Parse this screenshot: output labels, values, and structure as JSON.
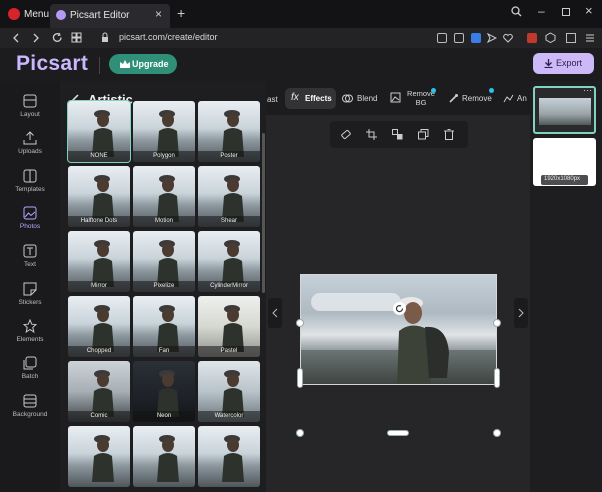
{
  "browser": {
    "menu_label": "Menu",
    "tab_title": "Picsart Editor",
    "url": "picsart.com/create/editor"
  },
  "header": {
    "logo": "Picsart",
    "upgrade_label": "Upgrade",
    "export_label": "Export"
  },
  "sidebar": {
    "items": [
      {
        "label": "Layout",
        "icon": "layout-icon"
      },
      {
        "label": "Uploads",
        "icon": "upload-icon"
      },
      {
        "label": "Templates",
        "icon": "templates-icon"
      },
      {
        "label": "Photos",
        "icon": "photos-icon"
      },
      {
        "label": "Text",
        "icon": "text-icon"
      },
      {
        "label": "Stickers",
        "icon": "stickers-icon"
      },
      {
        "label": "Elements",
        "icon": "elements-icon"
      },
      {
        "label": "Batch",
        "icon": "batch-icon"
      },
      {
        "label": "Background",
        "icon": "background-icon"
      }
    ]
  },
  "panel": {
    "title": "Artistic",
    "effects": [
      "NONE",
      "Polygon",
      "Poster",
      "Halftone Dots",
      "Motion",
      "Shear",
      "Mirror",
      "Pixelize",
      "CylinderMirror",
      "Chopped",
      "Fan",
      "Pastel",
      "Comic",
      "Neon",
      "Watercolor",
      "",
      "",
      ""
    ]
  },
  "toolbar": {
    "partial_label": "ast",
    "tabs": [
      "Effects",
      "Blend",
      "Remove BG",
      "Remove",
      "An"
    ]
  },
  "pages": {
    "size_label": "1920x1080px"
  },
  "colors": {
    "accent": "#b8a6ff",
    "upgrade_bg": "#2f8f78",
    "export_bg": "#cdb9f7",
    "selection": "#7fd3c0"
  }
}
